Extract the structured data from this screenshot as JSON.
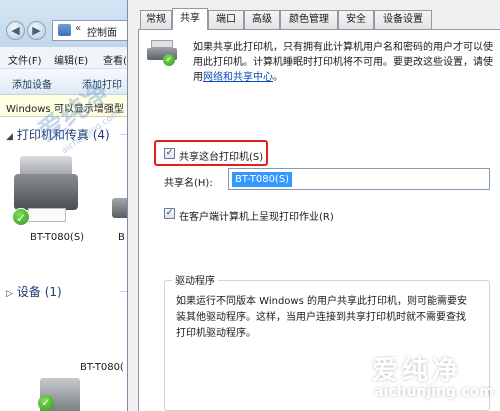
{
  "explorer": {
    "breadcrumb_sep": "«",
    "address_text": "控制面",
    "menu": [
      "文件(F)",
      "编辑(E)",
      "查看("
    ],
    "commands": [
      "添加设备",
      "添加打印"
    ],
    "info_bar": "Windows 可以显示增强型",
    "group_printers": "打印机和传真 (4)",
    "group_devices": "设备 (1)",
    "printer1_label": "BT-T080(S)",
    "printer2_label": "B",
    "printer3_label": "BT-T080(",
    "back_glyph": "◀",
    "forward_glyph": "▶"
  },
  "dialog": {
    "tabs": [
      "常规",
      "共享",
      "端口",
      "高级",
      "颜色管理",
      "安全",
      "设备设置"
    ],
    "active_tab": "共享",
    "intro_line1": "如果共享此打印机，只有拥有此计算机用户名和密码的用户才可以使",
    "intro_line2": "用此打印机。计算机睡眠时打印机将不可用。要更改这些设置，请使",
    "intro_line3_prefix": "用",
    "intro_link": "网络和共享中心",
    "intro_line3_suffix": "。",
    "share_checkbox_label": "共享这台打印机(S)",
    "share_name_label": "共享名(H):",
    "share_name_value": "BT-T080(S)",
    "render_jobs_label": "在客户端计算机上呈现打印作业(R)",
    "drivers_title": "驱动程序",
    "drivers_text_1": "如果运行不同版本 Windows 的用户共享此打印机，则可能需要安",
    "drivers_text_2": "装其他驱动程序。这样，当用户连接到共享打印机时就不需要查找",
    "drivers_text_3": "打印机驱动程序。",
    "check_glyph": "✓"
  },
  "watermark": {
    "center_text": "爱纯净",
    "center_url": "aichunjing.com",
    "brand": "爱纯净",
    "url": "aichunjing.com"
  },
  "colors": {
    "highlight_border": "#e02020",
    "link": "#0b4cb5",
    "selection": "#3399ff"
  }
}
